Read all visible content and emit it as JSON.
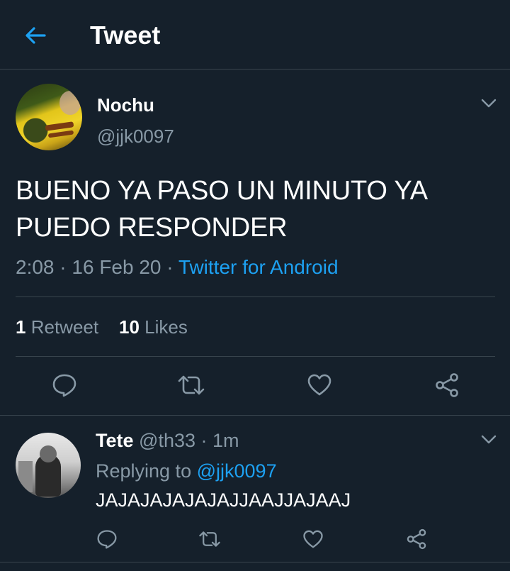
{
  "header": {
    "title": "Tweet",
    "back_icon": "back-arrow-icon"
  },
  "colors": {
    "background": "#15202b",
    "accent": "#1da1f2",
    "muted": "#8899a6",
    "divider": "#38444d"
  },
  "tweet": {
    "author_name": "Nochu",
    "author_handle": "@jjk0097",
    "text": "BUENO YA PASO UN MINUTO YA PUEDO RESPONDER",
    "time": "2:08",
    "sep1": "·",
    "date": "16 Feb 20",
    "sep2": "·",
    "source": "Twitter for Android",
    "retweet_count": "1",
    "retweet_label": "Retweet",
    "like_count": "10",
    "like_label": "Likes"
  },
  "reply": {
    "author_name": "Tete",
    "author_handle": "@th33",
    "sep": "·",
    "time": "1m",
    "replying_prefix": "Replying to",
    "replying_to": "@jjk0097",
    "text": "JAJAJAJAJAJAJJAAJJAJAAJ"
  }
}
